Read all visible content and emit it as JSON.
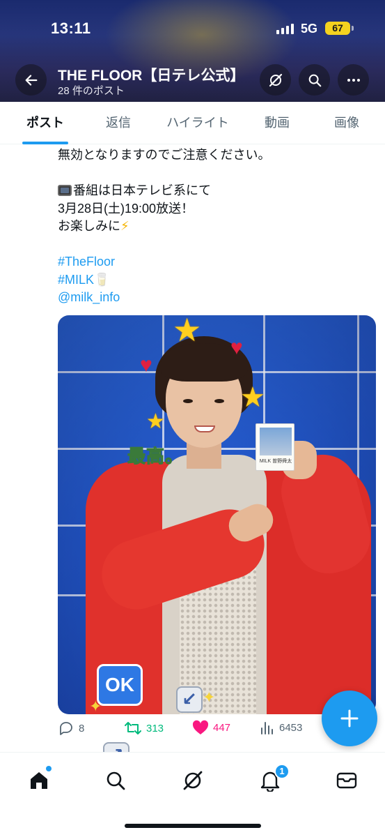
{
  "status_bar": {
    "time": "13:11",
    "network": "5G",
    "battery": "67"
  },
  "header": {
    "account_name": "THE FLOOR【日テレ公式】",
    "post_count": "28 件のポスト"
  },
  "tabs": [
    {
      "label": "ポスト",
      "active": true
    },
    {
      "label": "返信",
      "active": false
    },
    {
      "label": "ハイライト",
      "active": false
    },
    {
      "label": "動画",
      "active": false
    },
    {
      "label": "画像",
      "active": false
    }
  ],
  "tweet": {
    "line1": "無効となりますのでご注意ください。",
    "line2": "番組は日本テレビ系にて",
    "line3": "3月28日(土)19:00放送！",
    "line4": "お楽しみに",
    "hashtag1": "#TheFloor",
    "hashtag2": "#MILK",
    "mention": "@milk_info",
    "photo_stickers": {
      "caption": "最高。",
      "ok": "OK",
      "polaroid_text": "MILK 曽野舜太"
    }
  },
  "actions": {
    "replies": "8",
    "reposts": "313",
    "likes": "447",
    "views": "6453"
  },
  "bottom_nav": {
    "notifications_badge": "1"
  },
  "colors": {
    "accent": "#1d9bf0",
    "repost": "#00ba7c",
    "like": "#f91880",
    "text_secondary": "#536471"
  }
}
